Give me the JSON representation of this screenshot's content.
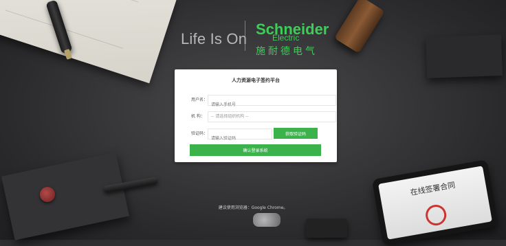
{
  "branding": {
    "tagline": "Life Is On",
    "company": "Schneider",
    "company_sub": "Electric",
    "company_cn": "施耐德电气"
  },
  "login": {
    "title": "人力资源电子签约平台",
    "fields": {
      "username": {
        "label": "用户名：",
        "placeholder": "请输入手机号"
      },
      "org": {
        "label": "机    构：",
        "value": "-- 请选择组织机构 --"
      },
      "code": {
        "label": "验证码：",
        "placeholder": "请输入验证码",
        "button": "获取验证码"
      }
    },
    "submit": "确认登录系统"
  },
  "footer": {
    "note": "建议使用浏览器：Google Chrome。"
  },
  "decor": {
    "tablet_title": "在线签署合同"
  },
  "colors": {
    "accent": "#3bb34a",
    "brand_green": "#3dcd58"
  }
}
